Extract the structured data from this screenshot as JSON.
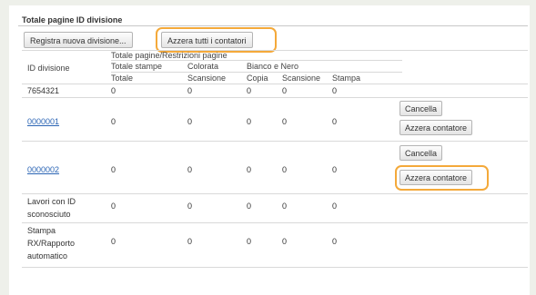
{
  "section": {
    "title": "Totale pagine ID divisione"
  },
  "toolbar": {
    "register_label": "Registra nuova divisione...",
    "reset_all_label": "Azzera tutti i contatori"
  },
  "table": {
    "header_main": "Totale pagine/Restrizioni pagine",
    "header_id": "ID divisione",
    "header_total_prints": "Totale stampe",
    "header_color": "Colorata",
    "header_bw": "Bianco e Nero",
    "sub_total": "Totale",
    "sub_color_scan": "Scansione",
    "sub_bw_copy": "Copia",
    "sub_bw_scan": "Scansione",
    "sub_bw_print": "Stampa",
    "rows": [
      {
        "id": "7654321",
        "values": [
          "0",
          "0",
          "0",
          "0",
          "0"
        ]
      },
      {
        "id": "0000001",
        "values": [
          "0",
          "0",
          "0",
          "0",
          "0"
        ],
        "delete_label": "Cancella",
        "reset_label": "Azzera contatore"
      },
      {
        "id": "0000002",
        "values": [
          "0",
          "0",
          "0",
          "0",
          "0"
        ],
        "delete_label": "Cancella",
        "reset_label": "Azzera contatore"
      },
      {
        "label": "Lavori con ID sconosciuto",
        "values": [
          "0",
          "0",
          "0",
          "0",
          "0"
        ]
      },
      {
        "label": "Stampa RX/Rapporto automatico",
        "values": [
          "0",
          "0",
          "0",
          "0",
          "0"
        ]
      }
    ]
  },
  "colors": {
    "highlight": "#f4a93a",
    "link": "#2a64b4",
    "background": "#eef0ea"
  }
}
